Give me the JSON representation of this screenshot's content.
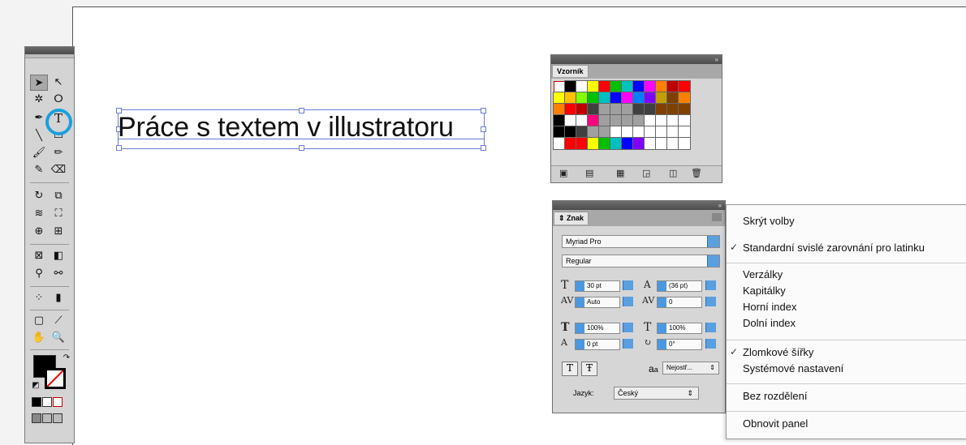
{
  "artboard": {
    "text": "Práce s textem v illustratoru"
  },
  "swatches_panel": {
    "title": "Vzorník",
    "colors": [
      "#ff0000",
      "#ffff00",
      "#00c000",
      "#00c0c0",
      "#0000ff",
      "#ff00ff",
      "#ff8000",
      "#c00000",
      "#00a000",
      "#0080ff",
      "#8000ff",
      "#c0a000",
      "#804000",
      "#a0a0a0",
      "#404040",
      "#ffffff",
      "#000000",
      "#ffc000",
      "#80ff00",
      "#ff0080"
    ]
  },
  "character_panel": {
    "title": "Znak",
    "font_family": "Myriad Pro",
    "font_style": "Regular",
    "size": "30 pt",
    "leading": "(36 pt)",
    "kerning": "Auto",
    "tracking": "0",
    "vscale": "100%",
    "hscale": "100%",
    "baseline_shift": "0 pt",
    "rotation": "0°",
    "antialias_glyph": "a",
    "antialias_glyph2": "a",
    "antialias": "Nejostř...",
    "language_label": "Jazyk:",
    "language": "Český"
  },
  "menu": {
    "items": [
      {
        "label": "Skrýt volby",
        "checked": false
      },
      {
        "label": "Standardní svislé zarovnání pro latinku",
        "checked": true
      },
      {
        "label": "Verzálky",
        "checked": false
      },
      {
        "label": "Kapitálky",
        "checked": false
      },
      {
        "label": "Horní index",
        "checked": false
      },
      {
        "label": "Dolní index",
        "checked": false
      },
      {
        "label": "Zlomkové šířky",
        "checked": true
      },
      {
        "label": "Systémové nastavení",
        "checked": false
      },
      {
        "label": "Bez rozdělení",
        "checked": false
      },
      {
        "label": "Obnovit panel",
        "checked": false
      }
    ],
    "check_glyph": "✓"
  },
  "icons": [
    "selection-icon",
    "direct-selection-icon",
    "magic-wand-icon",
    "lasso-icon",
    "pen-icon",
    "type-icon",
    "line-icon",
    "rectangle-icon",
    "paintbrush-icon",
    "pencil-icon",
    "blob-brush-icon",
    "eraser-icon",
    "rotate-icon",
    "scale-icon",
    "warp-icon",
    "free-transform-icon",
    "shape-builder-icon",
    "perspective-icon",
    "mesh-icon",
    "gradient-icon",
    "eyedropper-icon",
    "blend-icon",
    "symbol-sprayer-icon",
    "graph-icon",
    "artboard-icon",
    "slice-icon",
    "hand-icon",
    "zoom-icon"
  ]
}
